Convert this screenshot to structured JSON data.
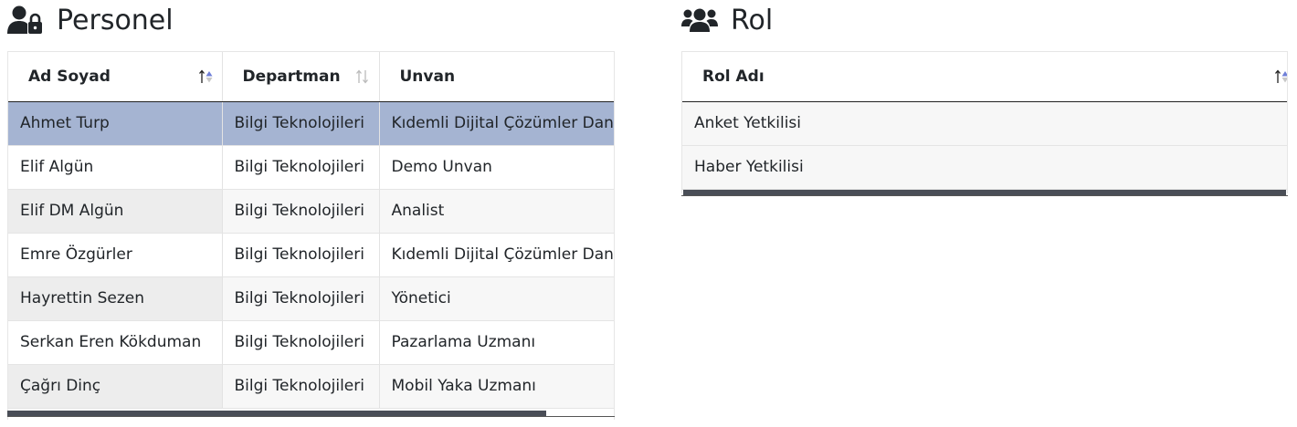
{
  "personel": {
    "title": "Personel",
    "icon": "user-lock-icon",
    "columns": [
      {
        "label": "Ad Soyad",
        "sort": "asc"
      },
      {
        "label": "Departman",
        "sort": "none"
      },
      {
        "label": "Unvan",
        "sort": "none"
      }
    ],
    "rows": [
      [
        "Ahmet Turp",
        "Bilgi Teknolojileri",
        "Kıdemli Dijital Çözümler Danışmanı"
      ],
      [
        "Elif Algün",
        "Bilgi Teknolojileri",
        "Demo Unvan"
      ],
      [
        "Elif DM Algün",
        "Bilgi Teknolojileri",
        "Analist"
      ],
      [
        "Emre Özgürler",
        "Bilgi Teknolojileri",
        "Kıdemli Dijital Çözümler Danışmanı"
      ],
      [
        "Hayrettin Sezen",
        "Bilgi Teknolojileri",
        "Yönetici"
      ],
      [
        "Serkan Eren Kökduman",
        "Bilgi Teknolojileri",
        "Pazarlama Uzmanı"
      ],
      [
        "Çağrı Dinç",
        "Bilgi Teknolojileri",
        "Mobil Yaka Uzmanı"
      ]
    ],
    "selected_row": 0
  },
  "rol": {
    "title": "Rol",
    "icon": "users-icon",
    "columns": [
      {
        "label": "Rol Adı",
        "sort": "asc"
      }
    ],
    "rows": [
      [
        "Anket Yetkilisi"
      ],
      [
        "Haber Yetkilisi"
      ]
    ]
  },
  "colors": {
    "selected_row": "#a5b4d2",
    "sort_active": "#6f7fd8",
    "scrollbar": "#4a4e57"
  }
}
